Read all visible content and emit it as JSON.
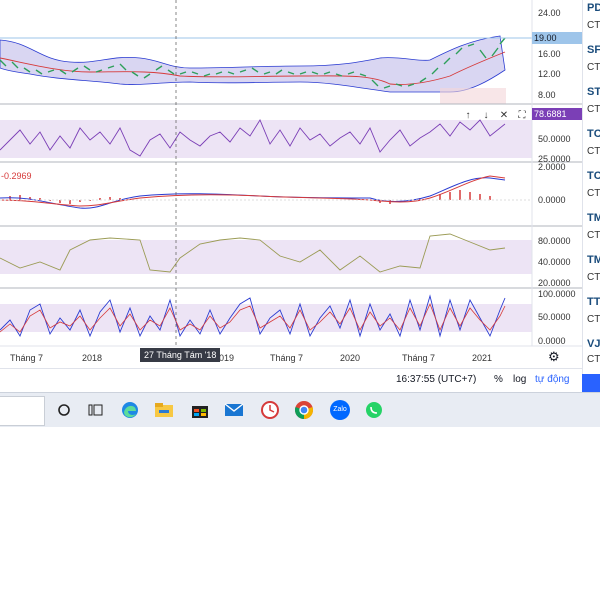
{
  "price_axis": {
    "ticks": [
      "24.00",
      "16.00",
      "12.00",
      "8.00"
    ],
    "last_value": "19.00"
  },
  "pane_rsi": {
    "ticks": [
      "50.0000",
      "25.0000"
    ],
    "last_value": "78.6881"
  },
  "pane_macd": {
    "value_text": "-0.2969",
    "ticks": [
      "2.0000",
      "0.0000"
    ]
  },
  "pane_3": {
    "ticks": [
      "80.0000",
      "40.0000",
      "20.0000"
    ]
  },
  "pane_stoch": {
    "ticks": [
      "100.0000",
      "50.0000",
      "0.0000"
    ]
  },
  "time_axis": {
    "labels": [
      "Tháng 7",
      "2018",
      "2019",
      "Tháng 7",
      "2020",
      "Tháng 7",
      "2021"
    ],
    "crosshair_tooltip": "27 Tháng Tám '18"
  },
  "pane_controls": {
    "up": "↑",
    "down": "↓",
    "close": "✕",
    "maximize": "⛶"
  },
  "settings_icon_glyph": "⚙",
  "bottom_bar": {
    "time": "16:37:55 (UTC+7)",
    "percent": "%",
    "log": "log",
    "auto": "tự động"
  },
  "watchlist": [
    {
      "symbol": "PD",
      "sub": "CT"
    },
    {
      "symbol": "SF",
      "sub": "CT"
    },
    {
      "symbol": "ST",
      "sub": "CT"
    },
    {
      "symbol": "TC",
      "sub": "CT"
    },
    {
      "symbol": "TC",
      "sub": "CT"
    },
    {
      "symbol": "TM",
      "sub": "CT"
    },
    {
      "symbol": "TM",
      "sub": "CT"
    },
    {
      "symbol": "TT",
      "sub": "CT"
    },
    {
      "symbol": "VJ",
      "sub": "CT"
    }
  ],
  "taskbar": {
    "icons": [
      "search-circle-icon",
      "task-view-icon",
      "edge-icon",
      "file-explorer-icon",
      "store-icon",
      "mail-icon",
      "clock-app-icon",
      "chrome-icon",
      "zalo-icon",
      "whatsapp-icon"
    ],
    "zalo_label": "Zalo"
  },
  "colors": {
    "bollinger_fill": "#d9d6f2",
    "band_line": "#2a3bd1",
    "mid_line": "#d63a3a",
    "rsi_fill": "#ede4f5",
    "macd_line": "#2a3bd1",
    "signal_line": "#d63a3a",
    "accent_blue": "#2962ff"
  }
}
